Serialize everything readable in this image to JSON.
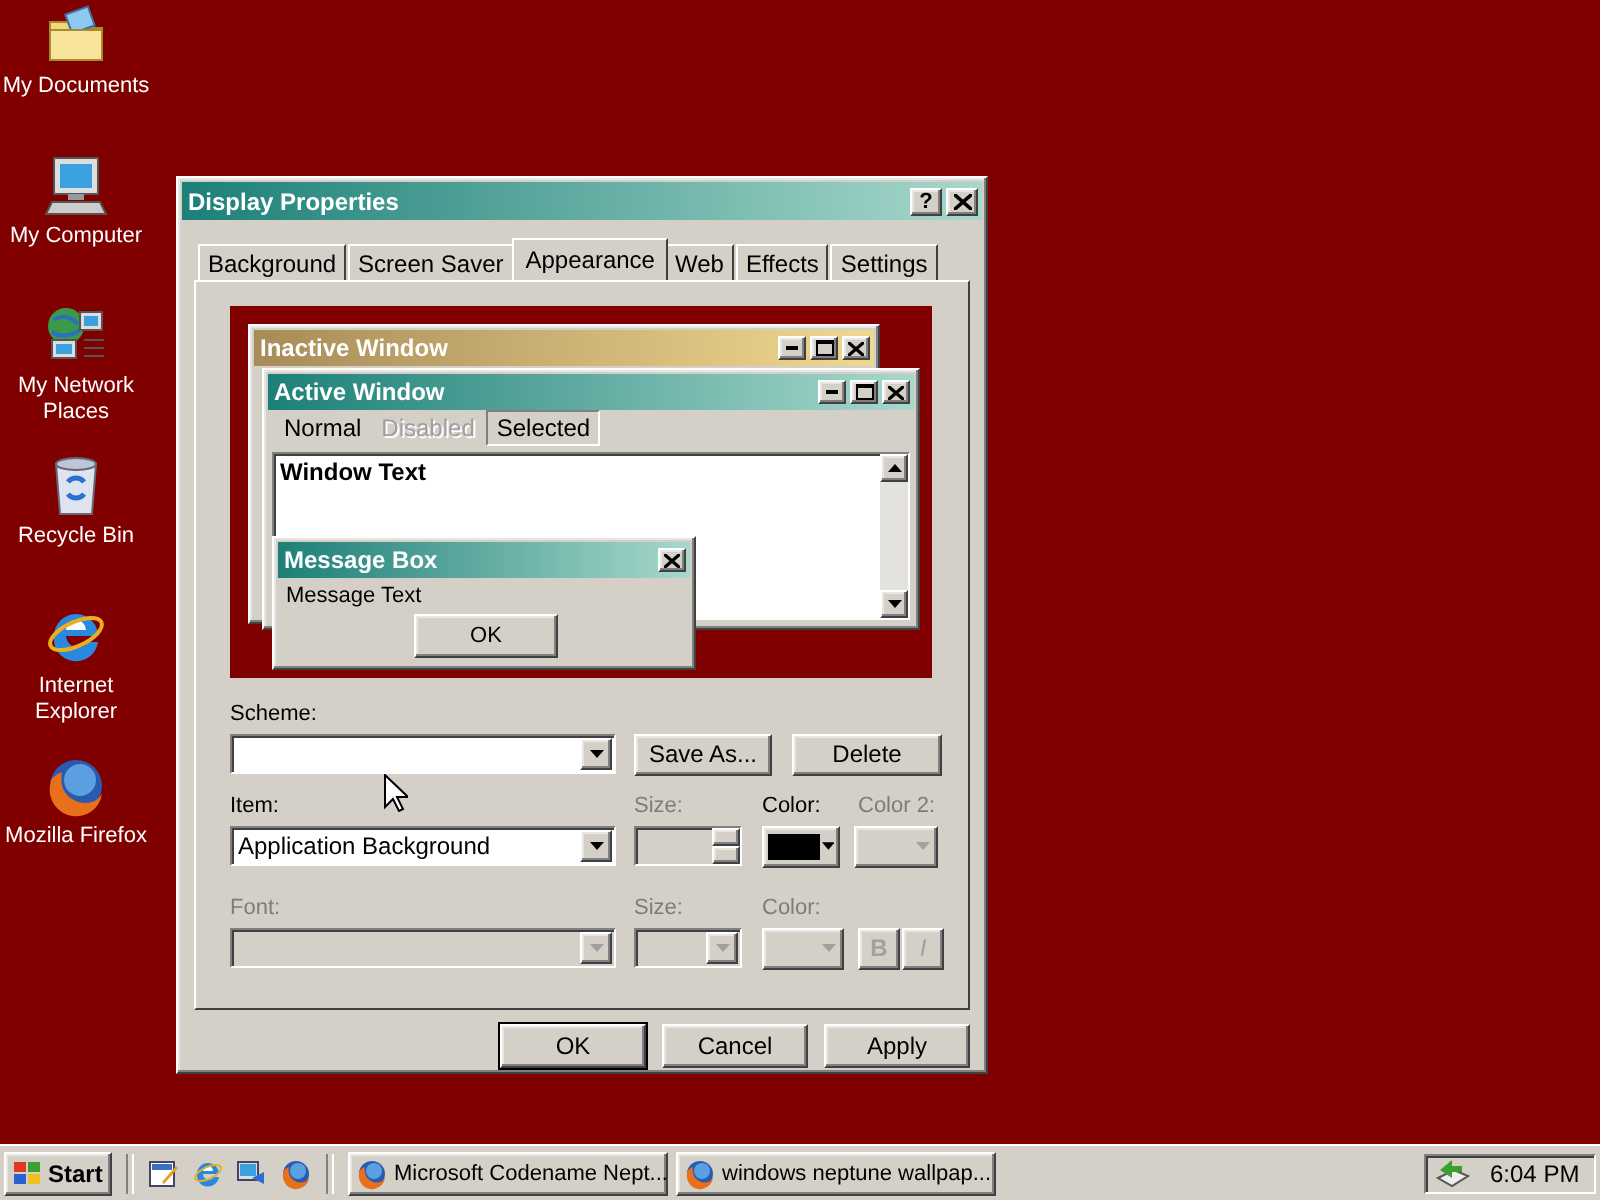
{
  "desktop_icons": [
    {
      "label": "My Documents",
      "kind": "documents"
    },
    {
      "label": "My Computer",
      "kind": "computer"
    },
    {
      "label": "My Network Places",
      "kind": "network"
    },
    {
      "label": "Recycle Bin",
      "kind": "recycle"
    },
    {
      "label": "Internet Explorer",
      "kind": "ie"
    },
    {
      "label": "Mozilla Firefox",
      "kind": "firefox"
    }
  ],
  "dialog": {
    "title": "Display Properties",
    "help_button": "?",
    "tabs": [
      {
        "label": "Background",
        "selected": false
      },
      {
        "label": "Screen Saver",
        "selected": false
      },
      {
        "label": "Appearance",
        "selected": true
      },
      {
        "label": "Web",
        "selected": false
      },
      {
        "label": "Effects",
        "selected": false
      },
      {
        "label": "Settings",
        "selected": false
      }
    ],
    "preview": {
      "inactive_title": "Inactive Window",
      "active_title": "Active Window",
      "menu": [
        {
          "label": "Normal",
          "kind": "normal"
        },
        {
          "label": "Disabled",
          "kind": "disabled"
        },
        {
          "label": "Selected",
          "kind": "selected"
        }
      ],
      "window_text": "Window Text",
      "message_title": "Message Box",
      "message_text": "Message Text",
      "message_button": "OK"
    },
    "scheme": {
      "label": "Scheme:",
      "save_button": "Save As...",
      "delete_button": "Delete"
    },
    "item": {
      "label": "Item:",
      "value": "Application Background"
    },
    "item_size": {
      "label": "Size:",
      "disabled": true
    },
    "item_color": {
      "label": "Color:",
      "disabled": false,
      "color": "#000000"
    },
    "item_color2": {
      "label": "Color 2:",
      "disabled": true
    },
    "font": {
      "label": "Font:",
      "disabled": true
    },
    "font_size": {
      "label": "Size:",
      "disabled": true
    },
    "font_color": {
      "label": "Color:",
      "disabled": true
    },
    "style_buttons": [
      {
        "label": "B",
        "kind": "bold",
        "disabled": true
      },
      {
        "label": "I",
        "kind": "italic",
        "disabled": true
      }
    ],
    "buttons": [
      {
        "label": "OK",
        "default": true
      },
      {
        "label": "Cancel",
        "default": false
      },
      {
        "label": "Apply",
        "default": false
      }
    ]
  },
  "taskbar": {
    "start": "Start",
    "quick_launch": [
      {
        "kind": "desktop"
      },
      {
        "kind": "ie"
      },
      {
        "kind": "network"
      },
      {
        "kind": "firefox"
      }
    ],
    "tasks": [
      {
        "label": "Microsoft Codename Nept...",
        "selected": false
      },
      {
        "label": "windows neptune wallpap...",
        "selected": false
      }
    ],
    "clock": "6:04 PM"
  }
}
